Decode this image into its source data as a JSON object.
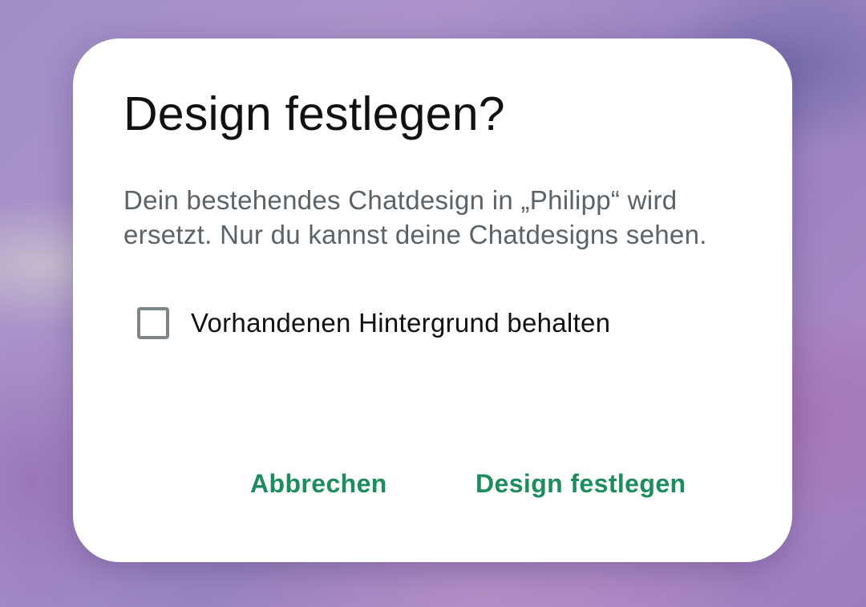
{
  "dialog": {
    "title": "Design festlegen?",
    "message": "Dein bestehendes Chatdesign in „Philipp“ wird ersetzt. Nur du kannst deine Chatdesigns sehen.",
    "checkbox": {
      "label": "Vorhandenen Hintergrund behalten",
      "checked": false
    },
    "buttons": {
      "cancel_label": "Abbrechen",
      "confirm_label": "Design festlegen"
    }
  },
  "colors": {
    "accent": "#1d8c5e",
    "title_text": "#111111",
    "body_text": "#5b6369",
    "checkbox_border": "#7d8589",
    "dialog_background": "#ffffff"
  }
}
